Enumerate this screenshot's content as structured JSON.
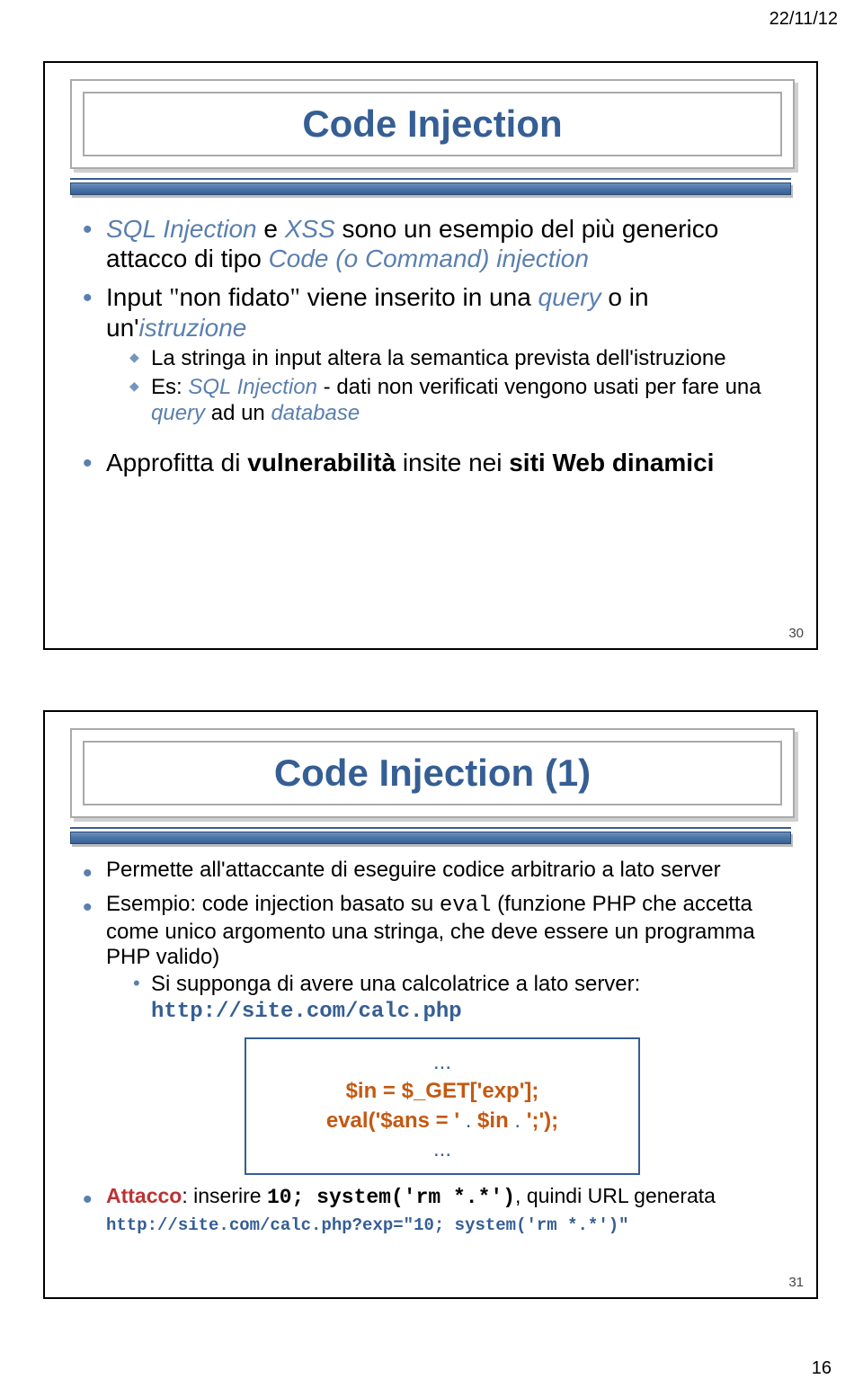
{
  "page": {
    "date": "22/11/12",
    "number": "16"
  },
  "slide1": {
    "title": "Code Injection",
    "b1a": "SQL Injection",
    "b1b": " e ",
    "b1c": "XSS",
    "b1d": " sono un esempio del più generico attacco di tipo ",
    "b1e": "Code (o Command) injection",
    "b2a": "Input ",
    "b2b": "non fidato",
    "b2c": " viene inserito in una ",
    "b2d": "query",
    "b2e": " o in un'",
    "b2f": "istruzione",
    "s2a": "La stringa in input altera la semantica prevista dell'istruzione",
    "s2b_pre": "Es: ",
    "s2b_it": "SQL Injection",
    "s2b_rest": " - dati non verificati vengono usati per fare una ",
    "s2b_query": "query",
    "s2b_end": " ad un ",
    "s2b_db": "database",
    "b3a": "Approfitta di ",
    "b3b": "vulnerabilità",
    "b3c": " insite nei ",
    "b3d": "siti Web dinamici",
    "num": "30"
  },
  "slide2": {
    "title": "Code Injection (1)",
    "b1": "Permette all'attaccante di eseguire codice arbitrario a lato server",
    "b2a": "Esempio: code injection basato su ",
    "b2b": "eval",
    "b2c": " (funzione PHP che accetta come unico argomento una stringa, che deve essere un programma PHP valido)",
    "s1a": "Si supponga di avere una calcolatrice a lato server: ",
    "s1b": "http://site.com/calc.php",
    "code_dots": "...",
    "code_l1a": "$in = $_GET[",
    "code_l1q1": "'",
    "code_l1b": "exp'];",
    "code_l2a": "eval('$ans = '",
    "code_l2b": " . ",
    "code_l2c": "$in",
    "code_l2d": " . ",
    "code_l2e": "';');",
    "b3a": "Attacco",
    "b3b": ": inserire ",
    "b3c": "10; system(",
    "b3q1": "'",
    "b3d": "rm *.*",
    "b3q2": "'",
    "b3e": ")",
    "b3f": ", quindi URL generata ",
    "b3g": "http://site.com/calc.php?exp=",
    "b3q3": "\"",
    "b3h": "10; system(",
    "b3q4": "'",
    "b3i": "rm *.*",
    "b3q5": "'",
    "b3j": ")",
    "b3q6": "\"",
    "num": "31"
  }
}
